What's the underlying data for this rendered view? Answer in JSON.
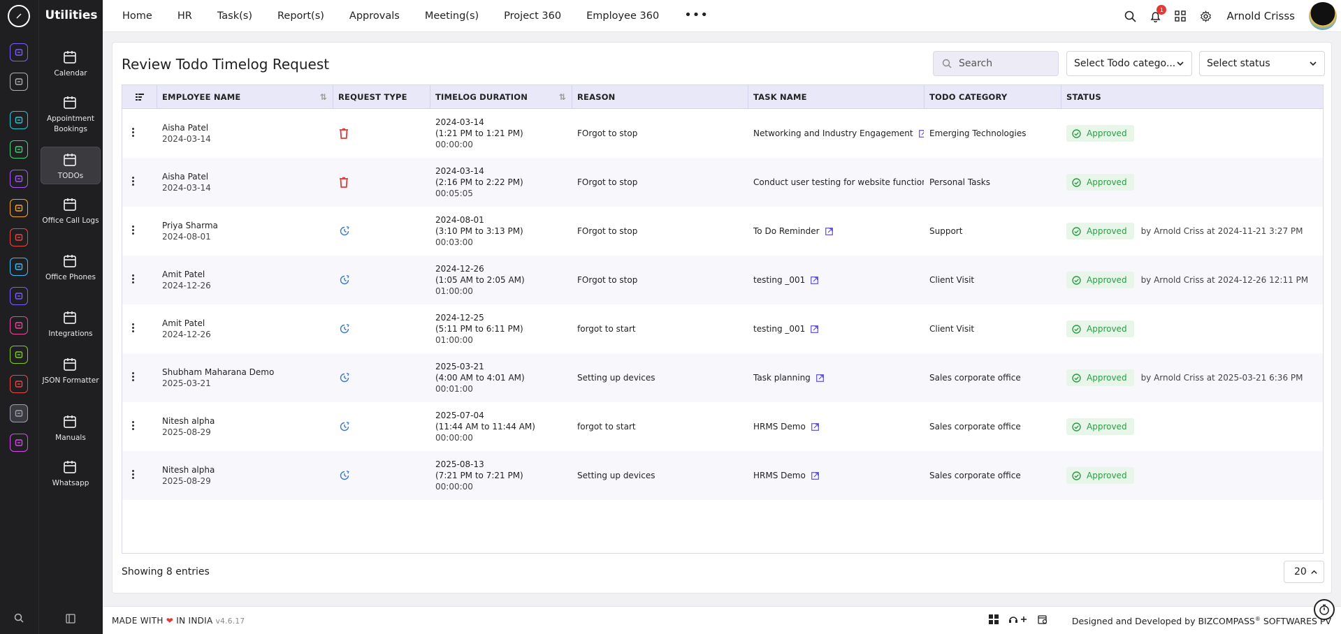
{
  "app": {
    "section_title": "Utilities"
  },
  "rail": {
    "colors": [
      "#7b5cff",
      "#b0b0b0",
      "#26c6da",
      "#43d17a",
      "#a855f7",
      "#f5a623",
      "#ef4444",
      "#38bdf8",
      "#7b5cff",
      "#ec4899",
      "#84cc16",
      "#ef4444",
      "#9ca3af",
      "#d946ef"
    ]
  },
  "utilities": [
    {
      "label": "Calendar",
      "icon": "calendar-icon"
    },
    {
      "label": "Appointment Bookings",
      "icon": "calendar-clock-icon"
    },
    {
      "label": "TODOs",
      "icon": "todo-calendar-icon",
      "active": true
    },
    {
      "label": "Office Call Logs",
      "icon": "phone-icon"
    },
    {
      "label": "Office Phones",
      "icon": "office-phone-icon"
    },
    {
      "label": "Integrations",
      "icon": "gear-icon"
    },
    {
      "label": "JSON Formatter",
      "icon": "code-icon"
    },
    {
      "label": "Manuals",
      "icon": "manual-icon"
    },
    {
      "label": "Whatsapp",
      "icon": "chat-icon"
    }
  ],
  "topnav": [
    "Home",
    "HR",
    "Task(s)",
    "Report(s)",
    "Approvals",
    "Meeting(s)",
    "Project 360",
    "Employee 360"
  ],
  "header": {
    "notification_count": "1",
    "user_name": "Arnold Crisss"
  },
  "page": {
    "title": "Review Todo Timelog Request",
    "search_placeholder": "Search",
    "category_select": "Select Todo catego...",
    "status_select": "Select status"
  },
  "table": {
    "columns": [
      "EMPLOYEE NAME",
      "REQUEST TYPE",
      "TIMELOG DURATION",
      "REASON",
      "TASK NAME",
      "TODO CATEGORY",
      "STATUS"
    ],
    "rows": [
      {
        "name": "Aisha Patel",
        "date": "2024-03-14",
        "type": "delete",
        "t_date": "2024-03-14",
        "t_range": "(1:21 PM to 1:21 PM)",
        "t_dur": "00:00:00",
        "reason": "FOrgot to stop",
        "task": "Networking and Industry Engagement",
        "category": "Emerging Technologies",
        "status": "Approved",
        "approver": ""
      },
      {
        "name": "Aisha Patel",
        "date": "2024-03-14",
        "type": "delete",
        "t_date": "2024-03-14",
        "t_range": "(2:16 PM to 2:22 PM)",
        "t_dur": "00:05:05",
        "reason": "FOrgot to stop",
        "task": "Conduct user testing for website function",
        "category": "Personal Tasks",
        "status": "Approved",
        "approver": ""
      },
      {
        "name": "Priya Sharma",
        "date": "2024-08-01",
        "type": "time",
        "t_date": "2024-08-01",
        "t_range": "(3:10 PM to 3:13 PM)",
        "t_dur": "00:03:00",
        "reason": "FOrgot to stop",
        "task": "To Do Reminder",
        "category": "Support",
        "status": "Approved",
        "approver": "by Arnold Criss at 2024-11-21 3:27 PM"
      },
      {
        "name": "Amit Patel",
        "date": "2024-12-26",
        "type": "time",
        "t_date": "2024-12-26",
        "t_range": "(1:05 AM to 2:05 AM)",
        "t_dur": "01:00:00",
        "reason": "FOrgot to stop",
        "task": "testing _001",
        "category": "Client Visit",
        "status": "Approved",
        "approver": "by Arnold Criss at 2024-12-26 12:11 PM"
      },
      {
        "name": "Amit Patel",
        "date": "2024-12-26",
        "type": "time",
        "t_date": "2024-12-25",
        "t_range": "(5:11 PM to 6:11 PM)",
        "t_dur": "01:00:00",
        "reason": "forgot to start",
        "task": "testing _001",
        "category": "Client Visit",
        "status": "Approved",
        "approver": ""
      },
      {
        "name": "Shubham Maharana Demo",
        "date": "2025-03-21",
        "type": "time",
        "t_date": "2025-03-21",
        "t_range": "(4:00 AM to 4:01 AM)",
        "t_dur": "00:01:00",
        "reason": "Setting up devices",
        "task": "Task planning",
        "category": "Sales corporate office",
        "status": "Approved",
        "approver": "by Arnold Criss at 2025-03-21 6:36 PM"
      },
      {
        "name": "Nitesh alpha",
        "date": "2025-08-29",
        "type": "time",
        "t_date": "2025-07-04",
        "t_range": "(11:44 AM to 11:44 AM)",
        "t_dur": "00:00:00",
        "reason": "forgot to start",
        "task": "HRMS Demo",
        "category": "Sales corporate office",
        "status": "Approved",
        "approver": ""
      },
      {
        "name": "Nitesh alpha",
        "date": "2025-08-29",
        "type": "time",
        "t_date": "2025-08-13",
        "t_range": "(7:21 PM to 7:21 PM)",
        "t_dur": "00:00:00",
        "reason": "Setting up devices",
        "task": "HRMS Demo",
        "category": "Sales corporate office",
        "status": "Approved",
        "approver": ""
      }
    ]
  },
  "footer": {
    "showing": "Showing 8 entries",
    "per_page": "20",
    "made_prefix": "MADE WITH",
    "made_suffix": "IN INDIA",
    "version": "v4.6.17",
    "designed_prefix": "Designed and Developed by",
    "brand": "BIZCOMPASS",
    "reg": "®",
    "brand_suffix": "SOFTWARES PV"
  }
}
